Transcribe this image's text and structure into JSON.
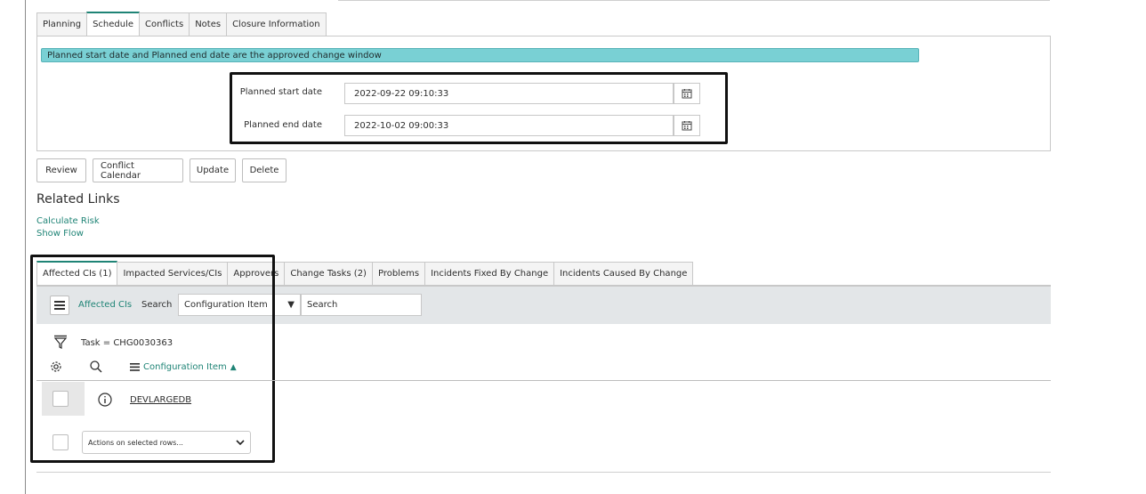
{
  "form_tabs": [
    "Planning",
    "Schedule",
    "Conflicts",
    "Notes",
    "Closure Information"
  ],
  "banner_text": "Planned start date and Planned end date are the approved change window",
  "fields": {
    "start_label": "Planned start date",
    "start_value": "2022-09-22 09:10:33",
    "end_label": "Planned end date",
    "end_value": "2022-10-02 09:00:33"
  },
  "buttons": [
    "Review",
    "Conflict Calendar",
    "Update",
    "Delete"
  ],
  "related": {
    "title": "Related Links",
    "links": [
      "Calculate Risk",
      "Show Flow"
    ]
  },
  "related_tabs": [
    "Affected CIs (1)",
    "Impacted Services/CIs",
    "Approvers",
    "Change Tasks (2)",
    "Problems",
    "Incidents Fixed By Change",
    "Incidents Caused By Change"
  ],
  "list": {
    "title": "Affected CIs",
    "search_label": "Search",
    "search_field": "Configuration Item",
    "search_placeholder": "Search",
    "filter_text": "Task = CHG0030363",
    "column_header": "Configuration Item",
    "sort_indicator": "▲",
    "rows": [
      {
        "ci": "DEVLARGEDB"
      }
    ],
    "actions_placeholder": "Actions on selected rows..."
  },
  "icons": {
    "calendar": "calendar-icon",
    "menu": "hamburger-icon",
    "filter": "filter-funnel-icon",
    "gear": "gear-icon",
    "search": "search-icon",
    "info": "info-icon"
  },
  "colors": {
    "accent": "#1f8476",
    "banner": "#79d0d4",
    "highlight_border": "#111111"
  }
}
